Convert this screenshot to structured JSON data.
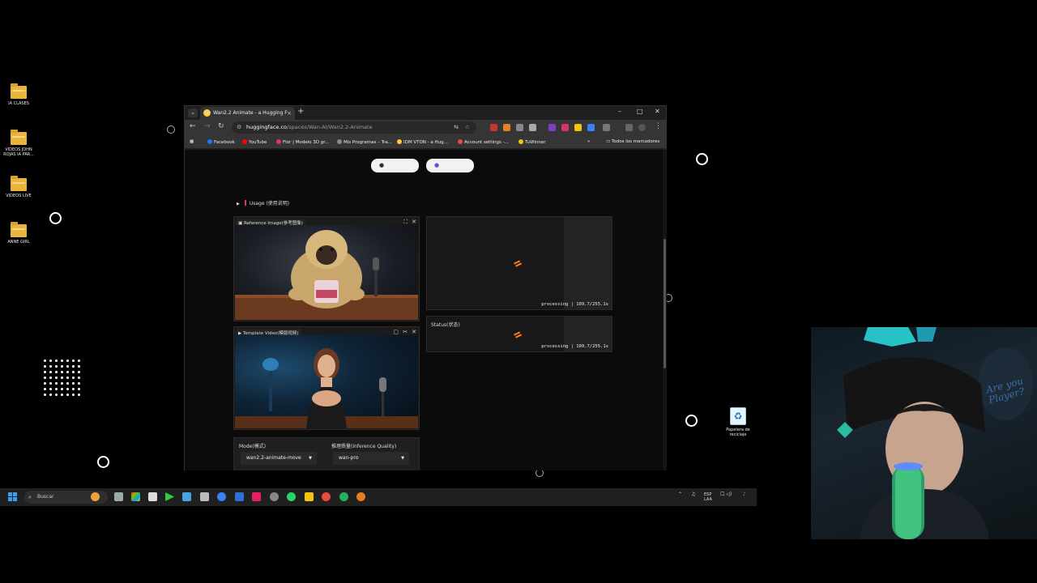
{
  "desktop": {
    "icons": [
      {
        "label": "IA CLASES"
      },
      {
        "label": "VIDEOS JOHN ROJAS IA PAR..."
      },
      {
        "label": "VIDEOS LIVE"
      },
      {
        "label": "ANNE GIRL"
      }
    ],
    "recycle_bin": "Papelera de reciclaje"
  },
  "browser": {
    "tab_title": "Wan2.2 Animate - a Hugging F",
    "url_host": "huggingface.co",
    "url_path": "/spaces/Wan-AI/Wan2.2-Animate",
    "bookmarks": [
      {
        "label": "Facebook",
        "color": "#1877f2"
      },
      {
        "label": "YouTube",
        "color": "#ff0000"
      },
      {
        "label": "Flor | Modelo 3D gr...",
        "color": "#e0365a"
      },
      {
        "label": "Mis Programas – Tra...",
        "color": "#888888"
      },
      {
        "label": "IDM VTON - a Hug...",
        "color": "#ffc83d"
      },
      {
        "label": "Account settings -...",
        "color": "#e74c3c"
      },
      {
        "label": "TuWinner",
        "color": "#f1c40f"
      }
    ],
    "all_bookmarks": "Todos los marcadores"
  },
  "app": {
    "usage_label": "Usage (使用说明)",
    "reference_label": "Reference Image(参考图像)",
    "template_label": "Template Video(模版视频)",
    "status_label": "Status(状态)",
    "processing_1": "processing | 109.7/255.1s",
    "processing_2": "processing | 109.7/255.1s",
    "mode_label": "Mode(模式)",
    "mode_value": "wan2.2-animate-move",
    "quality_label": "推理质量(Inference Quality)",
    "quality_value": "wan-pro",
    "accent_color": "#ff7a1a"
  },
  "taskbar": {
    "search_placeholder": "Buscar",
    "lang_1": "ESP",
    "lang_2": "LAA"
  },
  "webcam": {
    "sign_text": "Are you Player?"
  }
}
